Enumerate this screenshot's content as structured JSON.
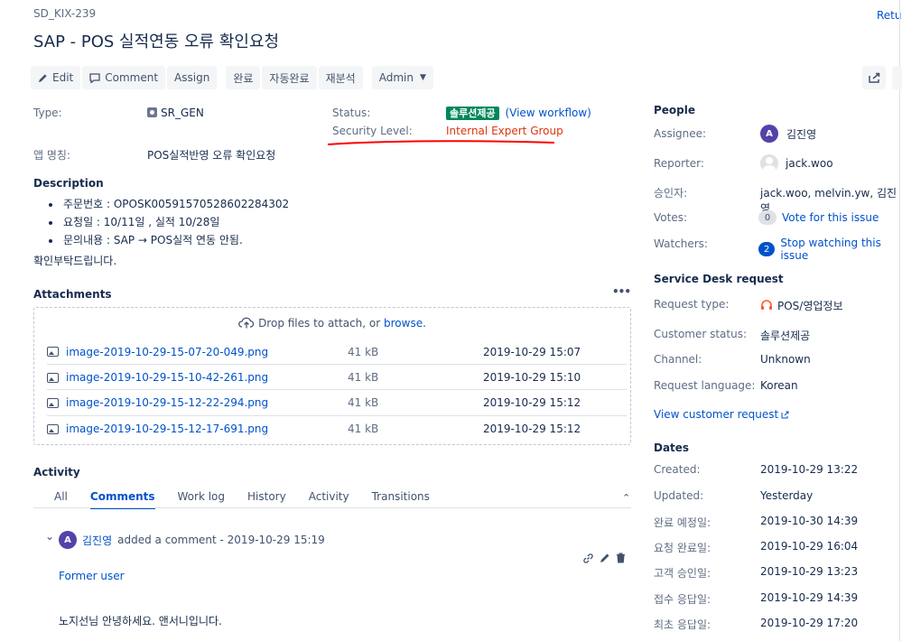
{
  "colors": {
    "accent": "#0052cc",
    "status": "#00875a",
    "security": "#de350b",
    "annotation": "#ff0000"
  },
  "issue": {
    "key": "SD_KIX-239",
    "title": "SAP - POS 실적연동 오류 확인요청",
    "return_label": "Retur"
  },
  "toolbar": {
    "edit": "Edit",
    "comment": "Comment",
    "assign": "Assign",
    "complete": "완료",
    "auto_complete": "자동완료",
    "reanalysis": "재분석",
    "admin": "Admin"
  },
  "details": {
    "type_label": "Type:",
    "type_value": "SR_GEN",
    "status_label": "Status:",
    "status_value": "솔루션제공",
    "view_workflow": "(View workflow)",
    "security_label": "Security Level:",
    "security_value": "Internal Expert Group",
    "app_label": "앱 명칭:",
    "app_value": "POS실적반영 오류 확인요청"
  },
  "description": {
    "title": "Description",
    "items": [
      "주문번호 : OPOSK00591570528602284302",
      "요청일 : 10/11일 , 실적 10/28일",
      "문의내용 : SAP → POS실적 연동 안됨."
    ],
    "closing": "확인부탁드립니다."
  },
  "attachments": {
    "title": "Attachments",
    "more": "•••",
    "drop_text": "Drop files to attach, or",
    "browse": "browse.",
    "files": [
      {
        "name": "image-2019-10-29-15-07-20-049.png",
        "size": "41 kB",
        "date": "2019-10-29 15:07"
      },
      {
        "name": "image-2019-10-29-15-10-42-261.png",
        "size": "41 kB",
        "date": "2019-10-29 15:10"
      },
      {
        "name": "image-2019-10-29-15-12-22-294.png",
        "size": "41 kB",
        "date": "2019-10-29 15:12"
      },
      {
        "name": "image-2019-10-29-15-12-17-691.png",
        "size": "41 kB",
        "date": "2019-10-29 15:12"
      }
    ]
  },
  "activity": {
    "title": "Activity",
    "tabs": [
      "All",
      "Comments",
      "Work log",
      "History",
      "Activity",
      "Transitions"
    ],
    "active_tab": "Comments",
    "comment": {
      "avatar": "A",
      "author": "김진영",
      "meta": "added a comment - 2019-10-29 15:19",
      "former_user": "Former user",
      "body": "노지선님 안녕하세요. 앤서니입니다."
    }
  },
  "people": {
    "title": "People",
    "assignee_label": "Assignee:",
    "assignee_avatar": "A",
    "assignee": "김진영",
    "reporter_label": "Reporter:",
    "reporter": "jack.woo",
    "approvers_label": "승인자:",
    "approvers": "jack.woo, melvin.yw, 김진영",
    "votes_label": "Votes:",
    "votes_count": "0",
    "vote_link": "Vote for this issue",
    "watchers_label": "Watchers:",
    "watchers_count": "2",
    "watch_link": "Stop watching this issue"
  },
  "service_desk": {
    "title": "Service Desk request",
    "request_type_label": "Request type:",
    "request_type": "POS/영업정보",
    "customer_status_label": "Customer status:",
    "customer_status": "솔루션제공",
    "channel_label": "Channel:",
    "channel": "Unknown",
    "language_label": "Request language:",
    "language": "Korean",
    "view_request": "View customer request"
  },
  "dates": {
    "title": "Dates",
    "rows": [
      {
        "label": "Created:",
        "value": "2019-10-29 13:22"
      },
      {
        "label": "Updated:",
        "value": "Yesterday"
      },
      {
        "label": "완료 예정일:",
        "value": "2019-10-30 14:39"
      },
      {
        "label": "요청 완료일:",
        "value": "2019-10-29 16:04"
      },
      {
        "label": "고객 승인일:",
        "value": "2019-10-29 13:23"
      },
      {
        "label": "접수 응답일:",
        "value": "2019-10-29 14:39"
      },
      {
        "label": "최초 응답일:",
        "value": "2019-10-29 17:20"
      }
    ]
  }
}
